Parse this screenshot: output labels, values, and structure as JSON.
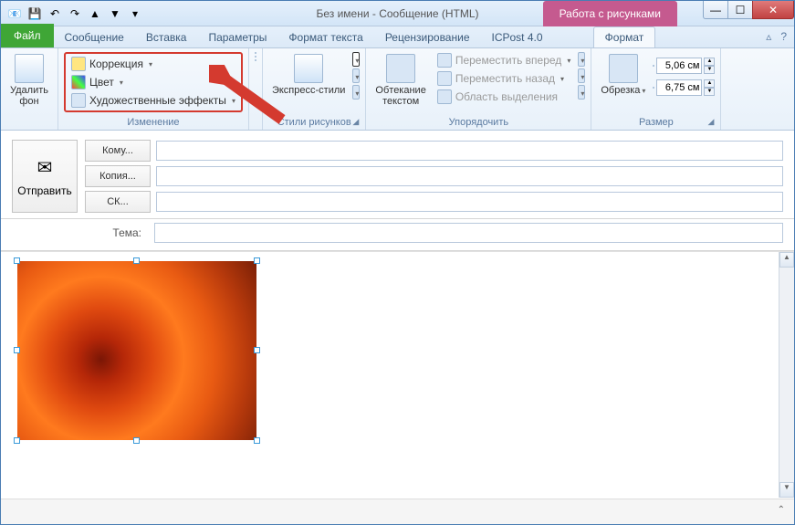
{
  "title": "Без имени  -  Сообщение (HTML)",
  "context_tab": "Работа с рисунками",
  "tabs": {
    "file": "Файл",
    "message": "Сообщение",
    "insert": "Вставка",
    "options": "Параметры",
    "format_text": "Формат текста",
    "review": "Рецензирование",
    "icpost": "ICPost 4.0",
    "format": "Формат"
  },
  "ribbon": {
    "remove_bg": "Удалить\nфон",
    "change": {
      "label": "Изменение",
      "corrections": "Коррекция",
      "color": "Цвет",
      "artistic": "Художественные эффекты"
    },
    "styles": {
      "label": "Стили рисунков",
      "express": "Экспресс-стили"
    },
    "arrange": {
      "label": "Упорядочить",
      "wrap": "Обтекание\nтекстом",
      "forward": "Переместить вперед",
      "backward": "Переместить назад",
      "selection_pane": "Область выделения"
    },
    "size": {
      "label": "Размер",
      "crop": "Обрезка",
      "height": "5,06 см",
      "width": "6,75 см"
    }
  },
  "compose": {
    "send": "Отправить",
    "to": "Кому...",
    "cc": "Копия...",
    "bcc": "СК...",
    "subject_label": "Тема:"
  },
  "window_controls": {
    "min": "—",
    "max": "☐",
    "close": "✕"
  }
}
